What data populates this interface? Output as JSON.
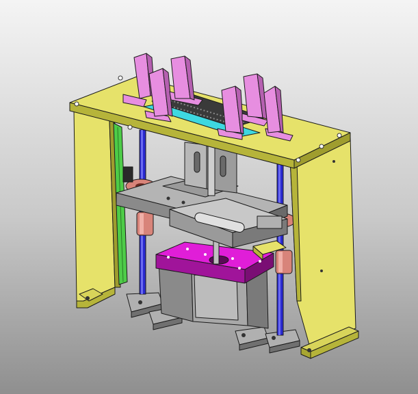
{
  "viewport": {
    "background_top": "#f4f4f4",
    "background_bottom": "#8f8f8f"
  },
  "model": {
    "description_parts": [
      "top-plate",
      "left-side-frame",
      "right-side-frame",
      "guide-rods",
      "moving-platen",
      "copper-bushings",
      "lower-magenta-plate",
      "motor-block",
      "base-feet",
      "fixture-brackets",
      "pcb-strip",
      "cyan-rail",
      "green-panel"
    ],
    "colors": {
      "frame_yellow": "#e6e26a",
      "frame_yellow_dark": "#b6b43a",
      "green_panel": "#4ecc48",
      "bracket_pink": "#e78ee0",
      "bracket_pink_dark": "#b560b0",
      "magenta_plate": "#e01ed8",
      "steel_gray": "#9a9a9a",
      "steel_light": "#c8c8c8",
      "steel_dark": "#6a6a6a",
      "rod_blue": "#2a2ad0",
      "bushing_copper": "#d8847a",
      "cyan_rail": "#3ed8e0",
      "pcb_dark": "#3a3a3a"
    }
  }
}
